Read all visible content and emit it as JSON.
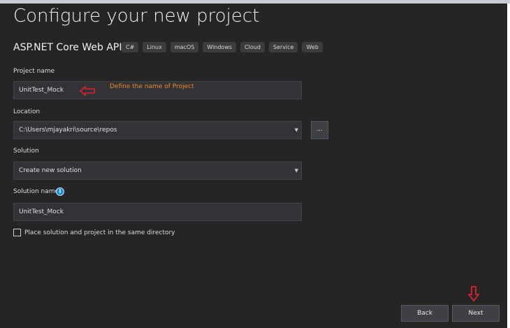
{
  "header": {
    "title": "Configure your new project",
    "project_type": "ASP.NET Core Web API",
    "tags": [
      "C#",
      "Linux",
      "macOS",
      "Windows",
      "Cloud",
      "Service",
      "Web"
    ]
  },
  "form": {
    "project_name_label": "Project name",
    "project_name_value": "UnitTest_Mock",
    "annotation": "Define the name of Project",
    "location_label": "Location",
    "location_value": "C:\\Users\\mjayakri\\source\\repos",
    "browse_label": "...",
    "solution_label": "Solution",
    "solution_value": "Create new solution",
    "solution_name_label": "Solution name",
    "solution_name_value": "UnitTest_Mock",
    "same_directory_label": "Place solution and project in the same directory",
    "same_directory_checked": false
  },
  "footer": {
    "back_label": "Back",
    "next_label": "Next"
  },
  "colors": {
    "background": "#252526",
    "field": "#333337",
    "annotation": "#e8892b",
    "arrow": "#e0202a",
    "info": "#1e8bd6"
  },
  "icons": {
    "info": "info-icon",
    "dropdown": "chevron-down-icon"
  }
}
